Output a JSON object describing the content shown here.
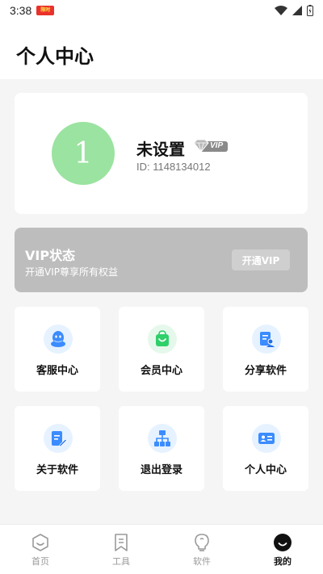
{
  "status_bar": {
    "time": "3:38",
    "app_badge": "限时"
  },
  "header": {
    "title": "个人中心"
  },
  "profile": {
    "avatar_text": "1",
    "name": "未设置",
    "vip_badge": "VIP",
    "id_text": "ID: 1148134012"
  },
  "vip_banner": {
    "title": "VIP状态",
    "description": "开通VIP尊享所有权益",
    "button_label": "开通VIP"
  },
  "tiles": [
    {
      "label": "客服中心",
      "icon": "customer-service-icon"
    },
    {
      "label": "会员中心",
      "icon": "shopping-bag-icon"
    },
    {
      "label": "分享软件",
      "icon": "share-document-icon"
    },
    {
      "label": "关于软件",
      "icon": "edit-document-icon"
    },
    {
      "label": "退出登录",
      "icon": "network-icon"
    },
    {
      "label": "个人中心",
      "icon": "id-card-icon"
    }
  ],
  "tabbar": {
    "active": "我的",
    "items": [
      {
        "label": "首页",
        "icon": "home-icon"
      },
      {
        "label": "工具",
        "icon": "bookmark-icon"
      },
      {
        "label": "软件",
        "icon": "lightbulb-icon"
      },
      {
        "label": "我的",
        "icon": "profile-smile-icon"
      }
    ]
  },
  "colors": {
    "avatar_bg": "#9be3a0",
    "vip_banner_bg": "#bdbdbd",
    "icon_bg": "#e6f2ff",
    "icon_accent": "#3b8cff",
    "member_icon_bg": "#e6f8ec",
    "member_icon": "#2fcf6a"
  }
}
